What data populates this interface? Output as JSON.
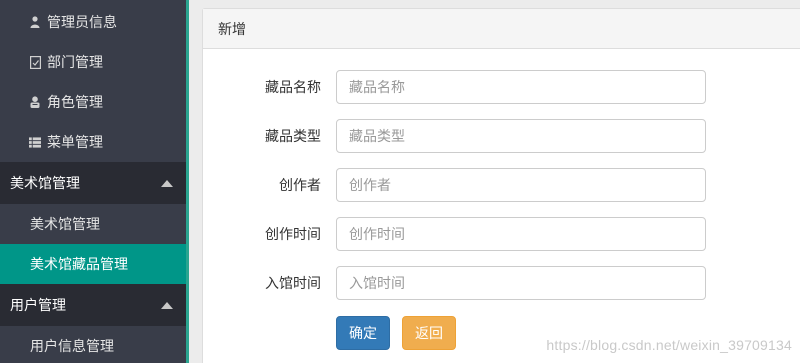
{
  "sidebar": {
    "admin_items": [
      {
        "label": "管理员信息",
        "icon": "user-icon"
      },
      {
        "label": "部门管理",
        "icon": "document-icon"
      },
      {
        "label": "角色管理",
        "icon": "role-icon"
      },
      {
        "label": "菜单管理",
        "icon": "list-icon"
      }
    ],
    "group_museum": {
      "label": "美术馆管理"
    },
    "museum_items": [
      {
        "label": "美术馆管理"
      },
      {
        "label": "美术馆藏品管理"
      }
    ],
    "group_user": {
      "label": "用户管理"
    },
    "user_items": [
      {
        "label": "用户信息管理"
      }
    ]
  },
  "panel": {
    "title": "新增",
    "fields": [
      {
        "label": "藏品名称",
        "placeholder": "藏品名称",
        "value": ""
      },
      {
        "label": "藏品类型",
        "placeholder": "藏品类型",
        "value": ""
      },
      {
        "label": "创作者",
        "placeholder": "创作者",
        "value": ""
      },
      {
        "label": "创作时间",
        "placeholder": "创作时间",
        "value": ""
      },
      {
        "label": "入馆时间",
        "placeholder": "入馆时间",
        "value": ""
      }
    ],
    "confirm_label": "确定",
    "back_label": "返回"
  },
  "watermark": "https://blog.csdn.net/weixin_39709134",
  "colors": {
    "sidebar_bg": "#393d49",
    "group_bg": "#292b33",
    "active_bg": "#009688",
    "primary": "#337ab7",
    "warning": "#f0ad4e"
  }
}
